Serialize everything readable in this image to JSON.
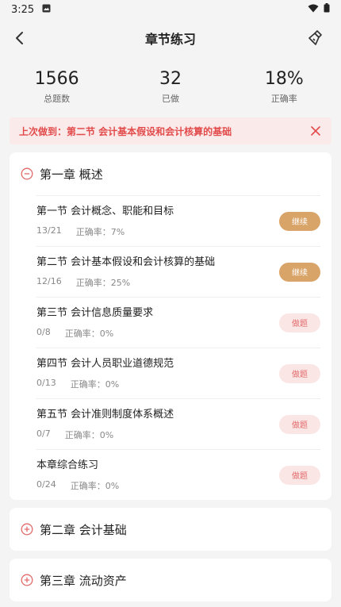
{
  "status": {
    "time": "3:25"
  },
  "nav": {
    "title": "章节练习"
  },
  "stats": [
    {
      "num": "1566",
      "label": "总题数"
    },
    {
      "num": "32",
      "label": "已做"
    },
    {
      "num": "18%",
      "label": "正确率"
    }
  ],
  "banner": {
    "text": "上次做到：第二节 会计基本假设和会计核算的基础"
  },
  "chapters": [
    {
      "title": "第一章 概述",
      "expanded": true,
      "sections": [
        {
          "name": "第一节 会计概念、职能和目标",
          "progress": "13/21",
          "accuracy": "正确率：7%",
          "button": "继续",
          "state": "continue"
        },
        {
          "name": "第二节 会计基本假设和会计核算的基础",
          "progress": "12/16",
          "accuracy": "正确率：25%",
          "button": "继续",
          "state": "continue"
        },
        {
          "name": "第三节 会计信息质量要求",
          "progress": "0/8",
          "accuracy": "正确率：0%",
          "button": "做题",
          "state": "start"
        },
        {
          "name": "第四节 会计人员职业道德规范",
          "progress": "0/13",
          "accuracy": "正确率：0%",
          "button": "做题",
          "state": "start"
        },
        {
          "name": "第五节 会计准则制度体系概述",
          "progress": "0/7",
          "accuracy": "正确率：0%",
          "button": "做题",
          "state": "start"
        },
        {
          "name": "本章综合练习",
          "progress": "0/24",
          "accuracy": "正确率：0%",
          "button": "做题",
          "state": "start"
        }
      ]
    },
    {
      "title": "第二章 会计基础",
      "expanded": false
    },
    {
      "title": "第三章 流动资产",
      "expanded": false
    }
  ],
  "colors": {
    "accent_red": "#e24b4b",
    "continue_bg": "#d9a468",
    "start_bg": "#fbe6e6"
  }
}
